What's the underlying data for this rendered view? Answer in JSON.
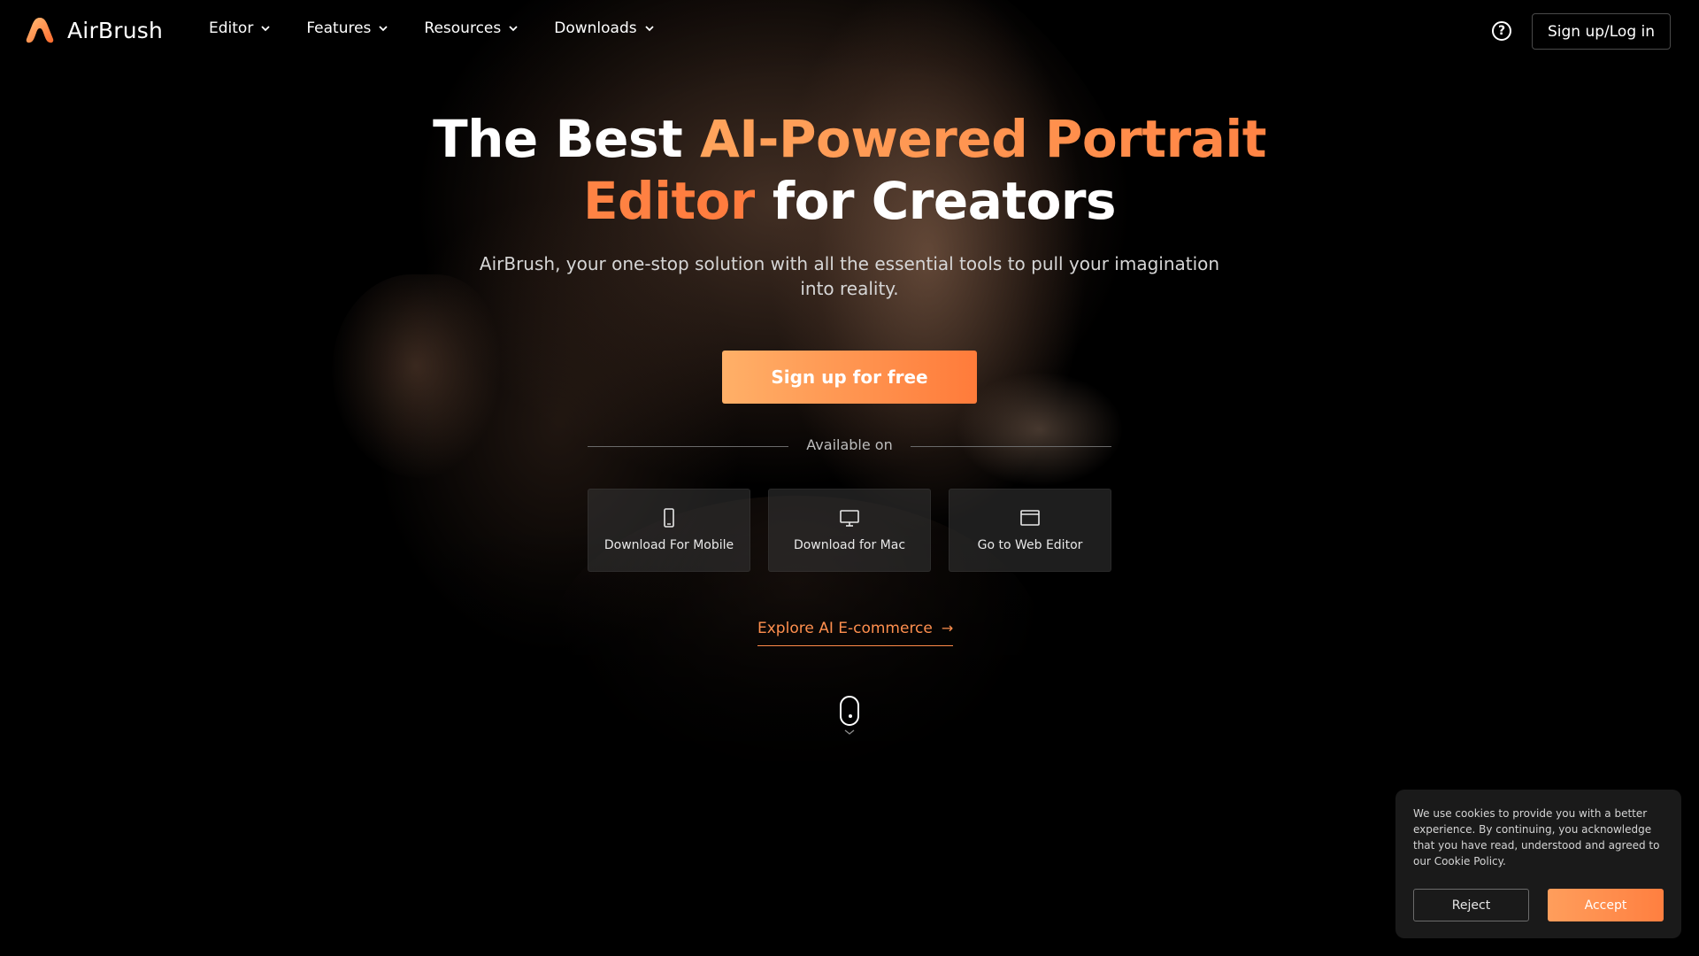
{
  "brand": {
    "name": "AirBrush",
    "accent": "#ff8a48"
  },
  "nav": {
    "items": [
      {
        "label": "Editor"
      },
      {
        "label": "Features"
      },
      {
        "label": "Resources"
      },
      {
        "label": "Downloads"
      }
    ],
    "help_icon": "help-circle-icon",
    "login_label": "Sign up/Log in"
  },
  "hero": {
    "title_part1": "The Best ",
    "title_accent": "AI-Powered Portrait Editor",
    "title_part2": " for Creators",
    "subtitle": "AirBrush, your one-stop solution with all the essential tools to pull your imagination into reality.",
    "cta_label": "Sign up for free",
    "available_label": "Available on",
    "downloads": [
      {
        "label": "Download For Mobile",
        "icon": "smartphone-icon"
      },
      {
        "label": "Download for Mac",
        "icon": "desktop-icon"
      },
      {
        "label": "Go to Web Editor",
        "icon": "browser-window-icon"
      }
    ],
    "explore_label": "Explore AI E-commerce",
    "explore_icon": "arrow-right-icon"
  },
  "cookie": {
    "text": "We use cookies to provide you with a better experience. By continuing, you acknowledge that you have read, understood and agreed to our Cookie Policy.",
    "reject_label": "Reject",
    "accept_label": "Accept"
  }
}
